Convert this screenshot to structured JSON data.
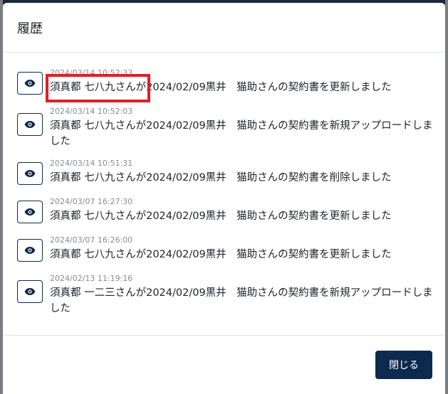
{
  "modal": {
    "title": "履歴",
    "close_label": "閉じる"
  },
  "colors": {
    "primary": "#0d2a4e",
    "highlight": "#e01f26"
  },
  "history": [
    {
      "timestamp": "2024/03/14 10:52:33",
      "message": "須真都 七八九さんが2024/02/09黒井　猫助さんの契約書を更新しました",
      "icon": "eye-icon"
    },
    {
      "timestamp": "2024/03/14 10:52:03",
      "message": "須真都 七八九さんが2024/02/09黒井　猫助さんの契約書を新規アップロードしました",
      "icon": "eye-icon"
    },
    {
      "timestamp": "2024/03/14 10:51:31",
      "message": "須真都 七八九さんが2024/02/09黒井　猫助さんの契約書を削除しました",
      "icon": "eye-icon"
    },
    {
      "timestamp": "2024/03/07 16:27:30",
      "message": "須真都 七八九さんが2024/02/09黒井　猫助さんの契約書を更新しました",
      "icon": "eye-icon"
    },
    {
      "timestamp": "2024/03/07 16:26:00",
      "message": "須真都 七八九さんが2024/02/09黒井　猫助さんの契約書を更新しました",
      "icon": "eye-icon"
    },
    {
      "timestamp": "2024/02/13 11:19:16",
      "message": "須真都 一二三さんが2024/02/09黒井　猫助さんの契約書を新規アップロードしました",
      "icon": "eye-icon"
    }
  ]
}
